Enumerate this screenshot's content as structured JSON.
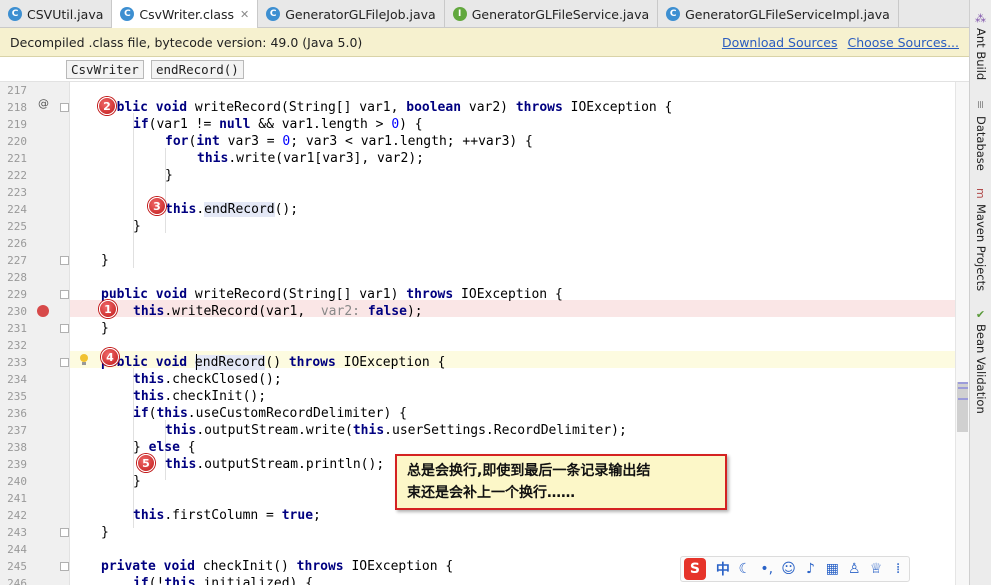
{
  "tabs": [
    {
      "label": "CSVUtil.java",
      "icon": "class-icon",
      "active": false
    },
    {
      "label": "CsvWriter.class",
      "icon": "class-icon",
      "active": true
    },
    {
      "label": "GeneratorGLFileJob.java",
      "icon": "class-icon",
      "active": false
    },
    {
      "label": "GeneratorGLFileService.java",
      "icon": "interface-icon",
      "active": false
    },
    {
      "label": "GeneratorGLFileServiceImpl.java",
      "icon": "class-icon",
      "active": false
    }
  ],
  "banner": {
    "message": "Decompiled .class file, bytecode version: 49.0 (Java 5.0)",
    "download_sources": "Download Sources",
    "choose_sources": "Choose Sources..."
  },
  "breadcrumb": {
    "class_name": "CsvWriter",
    "method_name": "endRecord()"
  },
  "right_tools": [
    "Ant Build",
    "Database",
    "Maven Projects",
    "Bean Validation"
  ],
  "code": [
    {
      "n": "217",
      "text": ""
    },
    {
      "n": "218",
      "text": "    public void writeRecord(String[] var1, boolean var2) throws IOException {"
    },
    {
      "n": "219",
      "text": "        if(var1 != null && var1.length > 0) {"
    },
    {
      "n": "220",
      "text": "            for(int var3 = 0; var3 < var1.length; ++var3) {"
    },
    {
      "n": "221",
      "text": "                this.write(var1[var3], var2);"
    },
    {
      "n": "222",
      "text": "            }"
    },
    {
      "n": "223",
      "text": ""
    },
    {
      "n": "224",
      "text": "            this.endRecord();"
    },
    {
      "n": "225",
      "text": "        }"
    },
    {
      "n": "226",
      "text": ""
    },
    {
      "n": "227",
      "text": "    }"
    },
    {
      "n": "228",
      "text": ""
    },
    {
      "n": "229",
      "text": "    public void writeRecord(String[] var1) throws IOException {"
    },
    {
      "n": "230",
      "text": "        this.writeRecord(var1,  var2: false);"
    },
    {
      "n": "231",
      "text": "    }"
    },
    {
      "n": "232",
      "text": ""
    },
    {
      "n": "233",
      "text": "    public void endRecord() throws IOException {"
    },
    {
      "n": "234",
      "text": "        this.checkClosed();"
    },
    {
      "n": "235",
      "text": "        this.checkInit();"
    },
    {
      "n": "236",
      "text": "        if(this.useCustomRecordDelimiter) {"
    },
    {
      "n": "237",
      "text": "            this.outputStream.write(this.userSettings.RecordDelimiter);"
    },
    {
      "n": "238",
      "text": "        } else {"
    },
    {
      "n": "239",
      "text": "            this.outputStream.println();"
    },
    {
      "n": "240",
      "text": "        }"
    },
    {
      "n": "241",
      "text": ""
    },
    {
      "n": "242",
      "text": "        this.firstColumn = true;"
    },
    {
      "n": "243",
      "text": "    }"
    },
    {
      "n": "244",
      "text": ""
    },
    {
      "n": "245",
      "text": "    private void checkInit() throws IOException {"
    },
    {
      "n": "246",
      "text": "        if(!this.initialized) {"
    }
  ],
  "badges": [
    "2",
    "3",
    "1",
    "4",
    "5"
  ],
  "callout": {
    "line1": "总是会换行,即使到最后一条记录输出结",
    "line2": "束还是会补上一个换行……"
  },
  "ime": {
    "lang": "中"
  },
  "colors": {
    "keyword": "#000080",
    "badge": "#c01818",
    "breakpoint": "#d74a4a",
    "banner": "#f6f1cf"
  }
}
